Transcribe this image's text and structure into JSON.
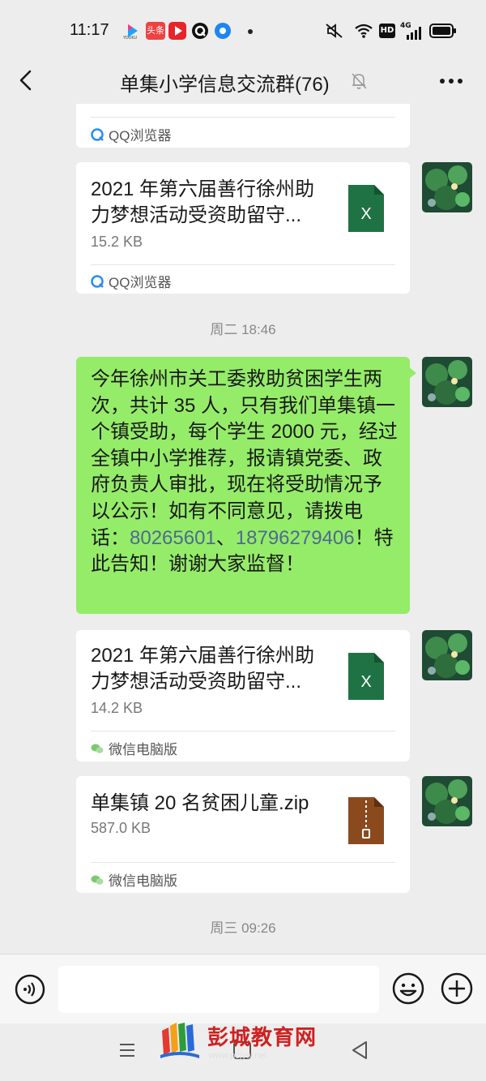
{
  "status_bar": {
    "time": "11:17",
    "app_icons": [
      "youku-icon",
      "toutiao-icon",
      "video-icon",
      "q-icon",
      "browser-icon",
      "dot-icon"
    ],
    "toutiao_text": "头条",
    "right_icons": [
      "mute-icon",
      "wifi-icon",
      "hd-icon",
      "signal-4g-icon",
      "battery-icon"
    ],
    "hd_label": "HD",
    "network_label": "4G"
  },
  "header": {
    "title": "单集小学信息交流群(76)",
    "back_icon": "chevron-left-icon",
    "mute_icon": "bell-off-icon",
    "more_icon": "more-icon"
  },
  "messages": {
    "partial_source": "QQ浏览器",
    "file1": {
      "name_line1": "2021 年第六届善行徐州助",
      "name_line2": "力梦想活动受资助留守...",
      "size": "15.2 KB",
      "source": "QQ浏览器"
    },
    "timestamp1": "周二 18:46",
    "text_msg": {
      "part1": "今年徐州市关工委救助贫困学生两次，共计 35 人，只有我们单集镇一个镇受助，每个学生 2000 元，经过全镇中小学推荐，报请镇党委、政府负责人审批，现在将受助情况予以公示！如有不同意见，请拨电话：",
      "phone1": "80265601",
      "sep": "、",
      "phone2": "18796279406",
      "part2": "！特此告知！谢谢大家监督！"
    },
    "file2": {
      "name_line1": "2021 年第六届善行徐州助",
      "name_line2": "力梦想活动受资助留守...",
      "size": "14.2 KB",
      "source": "微信电脑版"
    },
    "file3": {
      "name": "单集镇 20 名贫困儿童.zip",
      "size": "587.0 KB",
      "source": "微信电脑版"
    },
    "timestamp2": "周三 09:26",
    "excel_letter": "X"
  },
  "input_bar": {
    "voice_icon": "voice-icon",
    "emoji_icon": "emoji-icon",
    "plus_icon": "plus-icon",
    "text_value": ""
  },
  "nav_bar": {
    "menu_icon": "menu-icon",
    "home_icon": "home-icon",
    "back_icon": "triangle-back-icon"
  },
  "watermark": {
    "text": "彭城教育网",
    "url": "www.pcjyw.net"
  },
  "colors": {
    "green_bubble": "#95ec69",
    "excel_green": "#1f7244",
    "zip_brown": "#8b4a1e",
    "phone_link": "#4d6a8f"
  }
}
